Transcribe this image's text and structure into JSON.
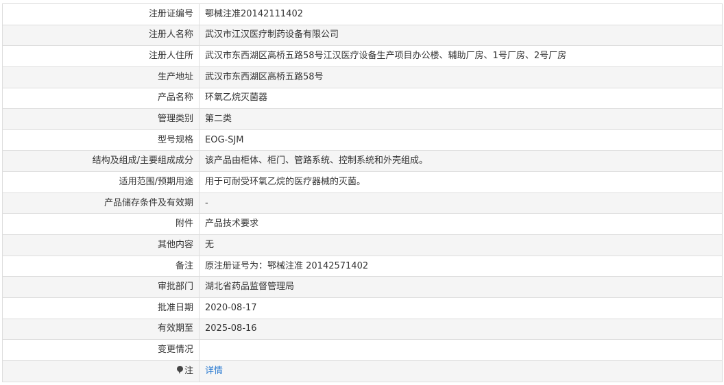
{
  "rows": [
    {
      "label": "注册证编号",
      "value": "鄂械注准20142111402"
    },
    {
      "label": "注册人名称",
      "value": "武汉市江汉医疗制药设备有限公司"
    },
    {
      "label": "注册人住所",
      "value": "武汉市东西湖区高桥五路58号江汉医疗设备生产项目办公楼、辅助厂房、1号厂房、2号厂房"
    },
    {
      "label": "生产地址",
      "value": "武汉市东西湖区高桥五路58号"
    },
    {
      "label": "产品名称",
      "value": "环氧乙烷灭菌器"
    },
    {
      "label": "管理类别",
      "value": "第二类"
    },
    {
      "label": "型号规格",
      "value": "EOG-SJM"
    },
    {
      "label": "结构及组成/主要组成成分",
      "value": "该产品由柜体、柜门、管路系统、控制系统和外壳组成。"
    },
    {
      "label": "适用范围/预期用途",
      "value": "用于可耐受环氧乙烷的医疗器械的灭菌。"
    },
    {
      "label": "产品储存条件及有效期",
      "value": "-"
    },
    {
      "label": "附件",
      "value": "产品技术要求"
    },
    {
      "label": "其他内容",
      "value": "无"
    },
    {
      "label": "备注",
      "value": "原注册证号为：鄂械注准 20142571402"
    },
    {
      "label": "审批部门",
      "value": "湖北省药品监督管理局"
    },
    {
      "label": "批准日期",
      "value": "2020-08-17"
    },
    {
      "label": "有效期至",
      "value": "2025-08-16"
    },
    {
      "label": "变更情况",
      "value": ""
    }
  ],
  "note": {
    "label": "注",
    "icon": "map-pin-icon",
    "link_text": "详情",
    "link_color": "#2b7bd1"
  },
  "colors": {
    "border": "#dddddd",
    "row_alt": "#f5f5f5",
    "text": "#333333"
  }
}
